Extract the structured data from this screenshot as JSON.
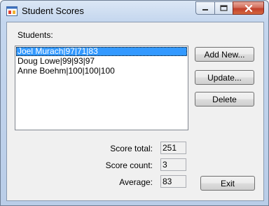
{
  "window": {
    "title": "Student Scores",
    "icon": "form-icon",
    "controls": {
      "minimize": "minimize-icon",
      "maximize": "maximize-icon",
      "close": "close-icon"
    }
  },
  "students_label": "Students:",
  "students": [
    {
      "text": "Joel Murach|97|71|83",
      "selected": true
    },
    {
      "text": "Doug Lowe|99|93|97",
      "selected": false
    },
    {
      "text": "Anne Boehm|100|100|100",
      "selected": false
    }
  ],
  "buttons": {
    "add_new": "Add New...",
    "update": "Update...",
    "delete": "Delete",
    "exit": "Exit"
  },
  "stats": {
    "score_total_label": "Score total:",
    "score_total": "251",
    "score_count_label": "Score count:",
    "score_count": "3",
    "average_label": "Average:",
    "average": "83"
  },
  "colors": {
    "selection": "#3399ff",
    "close_button": "#c2402c",
    "form_background": "#f0f0f0"
  }
}
